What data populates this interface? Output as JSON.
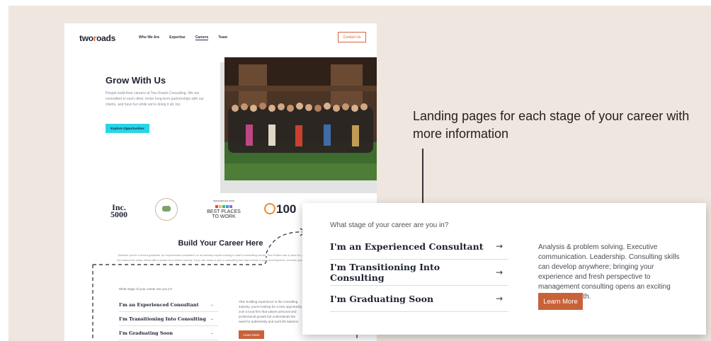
{
  "site": {
    "logo_prefix": "two",
    "logo_mid": "r",
    "logo_suffix": "oads",
    "nav": [
      "Who We Are",
      "Expertise",
      "Careers",
      "Team"
    ],
    "contact_label": "Contact Us",
    "hero": {
      "title": "Grow With Us",
      "text": "People build their careers at Two Roads Consulting. We are committed to each other, foster long-term partnerships with our clients, and have fun while we're doing it all, too.",
      "button": "Explore Opportunities"
    },
    "logos": {
      "inc": "Inc.\n5000",
      "bptw_small": "INDIANAPOLIS STAR",
      "bptw": "BEST PLACES\nTO WORK",
      "l100": "100"
    },
    "build": {
      "title": "Build Your Career Here",
      "text": "Whether you're a recent graduate, an experienced consultant, or an industry expert looking to start a consulting career, Two Roads has a place for you. We're always on the lookout for sharp minds with a knack for problem solving. If you are ready to join a consulting firm that invests in your development, consider growing with Two Roads."
    },
    "stage": {
      "question": "What stage of your career are you in?",
      "rows": [
        {
          "label": "I'm an Experienced Consultant",
          "arrow": "→"
        },
        {
          "label": "I'm Transitioning Into Consulting",
          "arrow": "→"
        },
        {
          "label": "I'm Graduating Soon",
          "arrow": "→"
        }
      ],
      "desc": "After building experience in the consulting industry, you're looking for a new opportunity. Join a local firm that values personal and professional growth but understands the need for authenticity and work life balance.",
      "button": "Learn More"
    }
  },
  "annotation": "Landing pages for each stage of your career with more information",
  "zoom": {
    "question": "What stage of your career are you in?",
    "rows": [
      {
        "label": "I'm an Experienced Consultant",
        "arrow": "→"
      },
      {
        "label": "I'm Transitioning Into Consulting",
        "arrow": "→"
      },
      {
        "label": "I'm Graduating Soon",
        "arrow": "→"
      }
    ],
    "desc": "Analysis & problem solving. Executive communication. Leadership. Consulting skills can develop anywhere; bringing your experience and fresh perspective to management consulting opens an exciting new career path.",
    "button": "Learn More"
  },
  "colors": {
    "background": "#efe6df",
    "accent_orange": "#c8623a",
    "accent_cyan": "#29d4e8",
    "navy": "#1e2233"
  }
}
